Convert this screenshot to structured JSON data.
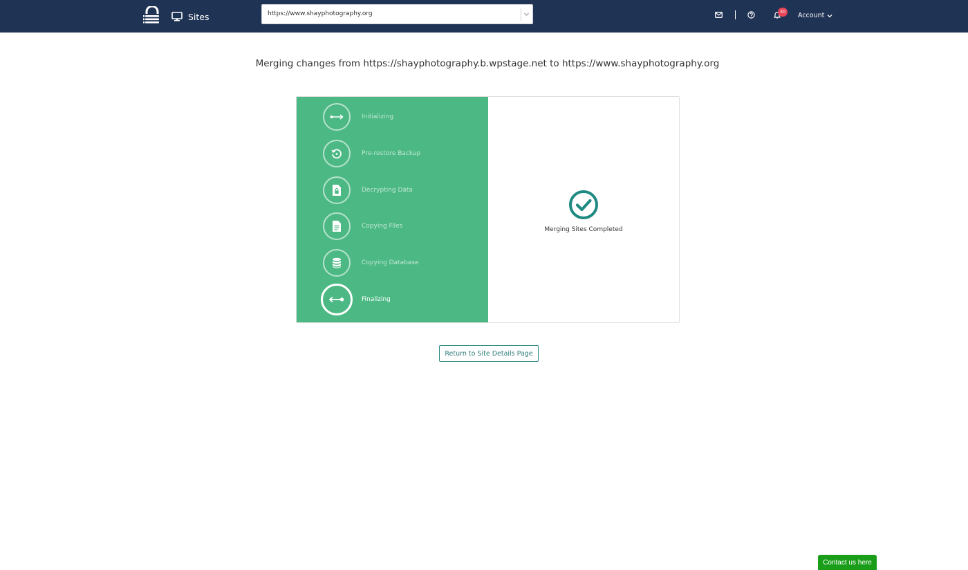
{
  "header": {
    "nav_label": "Sites",
    "site_select_value": "https://www.shayphotography.org",
    "notifications_count": "30",
    "account_label": "Account"
  },
  "main": {
    "heading": "Merging changes from https://shayphotography.b.wpstage.net  to https://www.shayphotography.org",
    "steps": [
      {
        "label": "Initializing",
        "icon": "arrows-horizontal-icon"
      },
      {
        "label": "Pre-restore Backup",
        "icon": "restore-icon"
      },
      {
        "label": "Decrypting Data",
        "icon": "file-lock-icon"
      },
      {
        "label": "Copying Files",
        "icon": "file-text-icon"
      },
      {
        "label": "Copying Database",
        "icon": "database-icon"
      },
      {
        "label": "Finalizing",
        "icon": "finalize-icon",
        "active": true
      }
    ],
    "status_text": "Merging Sites Completed",
    "return_button": "Return to Site Details Page"
  },
  "contact_button": "Contact us here",
  "colors": {
    "header_bg": "#1f3354",
    "steps_bg": "#4cb984",
    "accent_teal": "#2a8a82",
    "badge": "#e8455a",
    "contact_bg": "#1a9e1a"
  }
}
